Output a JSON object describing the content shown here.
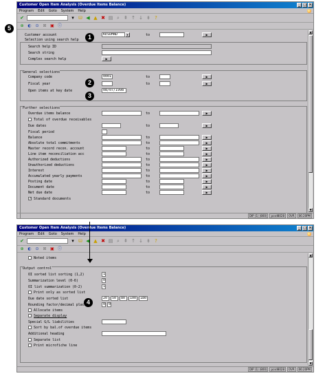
{
  "window1": {
    "title": "Customer Open Item Analysis (Overdue Items Balance)",
    "menu": [
      "Program",
      "Edit",
      "Goto",
      "System",
      "Help"
    ],
    "customer_account": {
      "label": "Customer account",
      "from": "KESOHND",
      "to": ""
    },
    "search_help": {
      "title": "Selection using search help",
      "id_label": "Search help ID",
      "string_label": "Search string",
      "complex_label": "Complex search help"
    },
    "general": {
      "title": "General selections",
      "company_code_label": "Company code",
      "company_code": "0001",
      "fiscal_year_label": "Fiscal year",
      "open_items_label": "Open items at key date",
      "open_items_date": "08/07/1998"
    },
    "further": {
      "title": "Further selections",
      "overdue_label": "Overdue items balance",
      "total_overdue_label": "Total of overdue receivables",
      "due_dates_label": "Due dates",
      "fiscal_period_label": "Fiscal period",
      "balance_label": "Balance",
      "commitments_label": "Absolute total commitments",
      "reconc_label": "Master record recon. account",
      "line_item_label": "Line item reconciliation acc",
      "auth_ded_label": "Authorized deductions",
      "unauth_ded_label": "Unauthorized deductions",
      "interest_label": "Interest",
      "yearly_label": "Accumulated yearly payments",
      "posting_label": "Posting date",
      "document_label": "Document date",
      "net_due_label": "Net due date",
      "standard_docs_label": "Standard documents"
    },
    "to_label": "to",
    "status": [
      "DIP (1) (800)",
      "pcsd8028",
      "OVR",
      "06:20PM"
    ]
  },
  "window2": {
    "title": "Customer Open Item Analysis (Overdue Items Balance)",
    "menu": [
      "Program",
      "Edit",
      "Goto",
      "System",
      "Help"
    ],
    "noted_label": "Noted items",
    "output_title": "Output control",
    "oi_sorted_label": "OI sorted list sorting (1,2)",
    "oi_sorted_value": "1",
    "summ_level_label": "Summarization level (0-6)",
    "summ_level_value": "0",
    "oi_list_summ_label": "OI list summarization (0-2)",
    "oi_list_summ_value": "1",
    "print_sorted_label": "Print only as sorted list",
    "due_date_sorted_label": "Due date sorted list",
    "due_date_values": [
      "20",
      "50",
      "80",
      "100",
      "180"
    ],
    "rounding_label": "Rounding factor/decimal places",
    "rounding_values": [
      "0",
      "0"
    ],
    "allocate_label": "Allocate items",
    "separate_display_label": "Separate display",
    "special_gl_label": "Special G/L liabilities",
    "sort_bal_label": "Sort by bal.of overdue items",
    "add_heading_label": "Additional heading",
    "separate_list_label": "Separate list",
    "microfiche_label": "Print microfiche line",
    "status": [
      "DIP (1) (800)",
      "pcsd8028",
      "OVR",
      "06:20PM"
    ]
  },
  "callouts": [
    "1",
    "2",
    "3",
    "4",
    "5"
  ]
}
